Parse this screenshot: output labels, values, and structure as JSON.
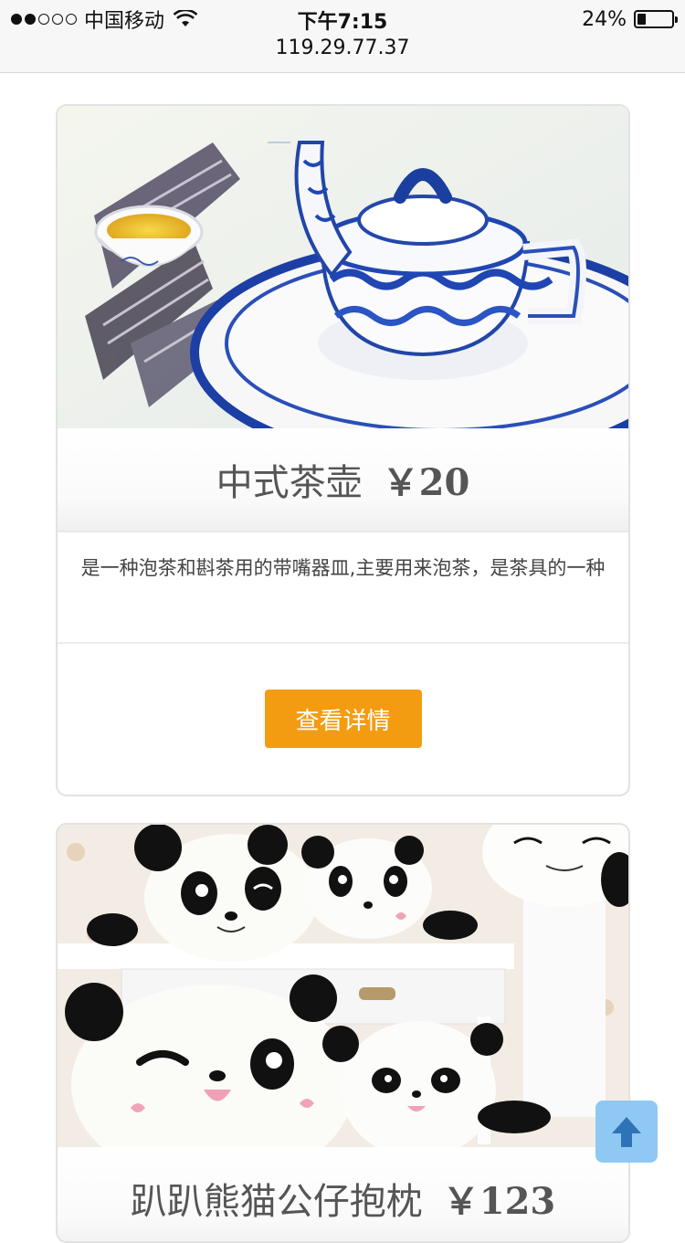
{
  "status_bar": {
    "carrier": "中国移动",
    "time": "下午7:15",
    "battery": "24%",
    "battery_level": 0.24,
    "url": "119.29.77.37",
    "signal_bars_filled": 2,
    "signal_bars_total": 5
  },
  "products": [
    {
      "name": "中式茶壶",
      "price": "￥20",
      "description": "是一种泡茶和斟茶用的带嘴器皿,主要用来泡茶，是茶具的一种",
      "button_label": "查看详情",
      "image": "blue-white-porcelain-teapot"
    },
    {
      "name": "趴趴熊猫公仔抱枕",
      "price": "￥123",
      "image": "panda-plush-pillows"
    }
  ],
  "colors": {
    "button_orange": "#f39c12",
    "back_to_top_blue": "#8fc9f3"
  },
  "icons": {
    "back_to_top": "arrow-up-icon",
    "wifi": "wifi-icon",
    "battery": "battery-icon"
  }
}
